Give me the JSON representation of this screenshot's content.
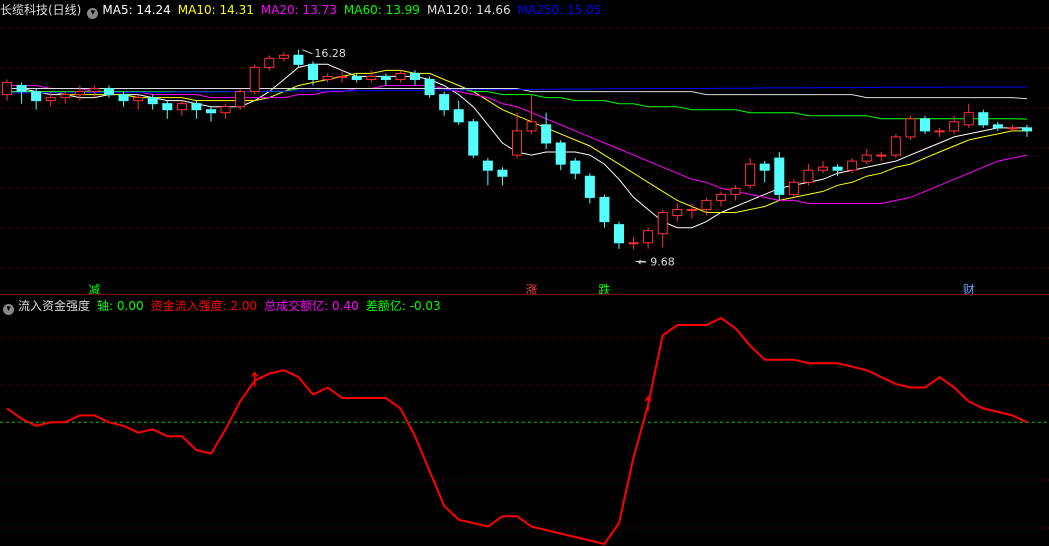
{
  "colors": {
    "up": "#ff3232",
    "down": "#54ffff",
    "background": "#000000",
    "ma5": "#ffffff",
    "ma10": "#ffff00",
    "ma20": "#ff00ff",
    "ma60": "#00ff00",
    "ma120": "#dcdcdc",
    "ma250": "#0000ff",
    "zero_line": "#00c000",
    "indicator": "#ff0000",
    "grid": "#7a0000"
  },
  "top_legend": {
    "icon": "chevron-down-icon",
    "title": "长缆科技(日线)",
    "items": [
      {
        "label": "MA5: 14.24",
        "color": "#ffffff"
      },
      {
        "label": "MA10: 14.31",
        "color": "#ffff00"
      },
      {
        "label": "MA20: 13.73",
        "color": "#ff00ff"
      },
      {
        "label": "MA60: 13.99",
        "color": "#00ff00"
      },
      {
        "label": "MA120: 14.66",
        "color": "#dcdcdc"
      },
      {
        "label": "MA250: 15.05",
        "color": "#0000ff"
      }
    ]
  },
  "bottom_legend": {
    "icon": "chevron-down-icon",
    "title": "流入资金强度",
    "items": [
      {
        "label": "轴: 0.00",
        "color": "#00ff00"
      },
      {
        "label": "资金流入强度: 2.00",
        "color": "#ff0000"
      },
      {
        "label": "总成交额亿: 0.40",
        "color": "#ff00ff"
      },
      {
        "label": "差额亿: -0.03",
        "color": "#00ff00"
      }
    ]
  },
  "chart_data": [
    {
      "type": "candlestick",
      "title": "长缆科技(日线)",
      "ylim": [
        9.0,
        17.2
      ],
      "candles": [
        [
          14.8,
          15.2,
          15.3,
          14.6
        ],
        [
          15.1,
          14.9,
          15.2,
          14.5
        ],
        [
          14.9,
          14.6,
          15.0,
          14.3
        ],
        [
          14.6,
          14.7,
          14.9,
          14.4
        ],
        [
          14.7,
          14.8,
          14.9,
          14.5
        ],
        [
          14.8,
          14.9,
          15.1,
          14.6
        ],
        [
          14.9,
          15.0,
          15.1,
          14.7
        ],
        [
          15.0,
          14.8,
          15.1,
          14.7
        ],
        [
          14.8,
          14.6,
          14.9,
          14.4
        ],
        [
          14.6,
          14.7,
          14.8,
          14.3
        ],
        [
          14.7,
          14.5,
          14.8,
          14.3
        ],
        [
          14.5,
          14.3,
          14.6,
          14.0
        ],
        [
          14.3,
          14.5,
          14.6,
          14.1
        ],
        [
          14.5,
          14.3,
          14.6,
          14.0
        ],
        [
          14.3,
          14.2,
          14.4,
          13.9
        ],
        [
          14.2,
          14.4,
          14.5,
          14.0
        ],
        [
          14.4,
          14.9,
          15.0,
          14.3
        ],
        [
          14.9,
          15.7,
          15.8,
          14.8
        ],
        [
          15.7,
          16.0,
          16.1,
          15.6
        ],
        [
          16.0,
          16.1,
          16.2,
          15.9
        ],
        [
          16.1,
          15.8,
          16.28,
          15.7
        ],
        [
          15.8,
          15.3,
          15.9,
          15.1
        ],
        [
          15.3,
          15.4,
          15.5,
          15.2
        ],
        [
          15.4,
          15.4,
          15.6,
          15.2
        ],
        [
          15.4,
          15.3,
          15.5,
          15.2
        ],
        [
          15.3,
          15.4,
          15.6,
          15.2
        ],
        [
          15.4,
          15.3,
          15.5,
          15.1
        ],
        [
          15.3,
          15.5,
          15.6,
          15.2
        ],
        [
          15.5,
          15.3,
          15.6,
          15.1
        ],
        [
          15.3,
          14.8,
          15.4,
          14.7
        ],
        [
          14.8,
          14.3,
          14.9,
          14.1
        ],
        [
          14.3,
          13.9,
          14.6,
          13.8
        ],
        [
          13.9,
          12.8,
          14.0,
          12.7
        ],
        [
          12.6,
          12.3,
          12.7,
          11.8
        ],
        [
          12.3,
          12.1,
          12.4,
          11.8
        ],
        [
          12.8,
          13.6,
          14.2,
          12.7
        ],
        [
          13.6,
          13.9,
          14.8,
          13.5
        ],
        [
          13.8,
          13.2,
          14.2,
          13.0
        ],
        [
          13.2,
          12.5,
          13.3,
          12.3
        ],
        [
          12.6,
          12.2,
          12.7,
          12.0
        ],
        [
          12.1,
          11.4,
          12.2,
          11.2
        ],
        [
          11.4,
          10.6,
          11.5,
          10.4
        ],
        [
          10.5,
          9.9,
          10.6,
          9.7
        ],
        [
          9.9,
          9.9,
          10.1,
          9.68
        ],
        [
          9.9,
          10.3,
          10.4,
          9.7
        ],
        [
          10.2,
          10.9,
          11.0,
          9.75
        ],
        [
          10.8,
          11.0,
          11.2,
          10.6
        ],
        [
          11.0,
          11.0,
          11.2,
          10.7
        ],
        [
          11.0,
          11.3,
          11.4,
          10.8
        ],
        [
          11.3,
          11.5,
          11.6,
          11.1
        ],
        [
          11.5,
          11.7,
          11.8,
          11.3
        ],
        [
          11.8,
          12.5,
          12.7,
          11.7
        ],
        [
          12.5,
          12.3,
          12.6,
          11.9
        ],
        [
          12.7,
          11.5,
          12.9,
          11.3
        ],
        [
          11.5,
          11.9,
          12.0,
          11.4
        ],
        [
          11.9,
          12.3,
          12.5,
          11.8
        ],
        [
          12.3,
          12.4,
          12.6,
          12.2
        ],
        [
          12.4,
          12.3,
          12.5,
          12.1
        ],
        [
          12.3,
          12.6,
          12.7,
          12.2
        ],
        [
          12.6,
          12.8,
          13.0,
          12.5
        ],
        [
          12.8,
          12.8,
          12.9,
          12.6
        ],
        [
          12.8,
          13.4,
          13.5,
          12.7
        ],
        [
          13.4,
          14.0,
          14.1,
          13.3
        ],
        [
          14.0,
          13.6,
          14.1,
          13.5
        ],
        [
          13.6,
          13.6,
          13.7,
          13.4
        ],
        [
          13.6,
          13.9,
          14.1,
          13.5
        ],
        [
          13.8,
          14.2,
          14.5,
          13.7
        ],
        [
          14.2,
          13.8,
          14.3,
          13.7
        ],
        [
          13.8,
          13.7,
          13.9,
          13.6
        ],
        [
          13.7,
          13.7,
          13.8,
          13.6
        ],
        [
          13.7,
          13.6,
          13.8,
          13.4
        ]
      ],
      "series": [
        {
          "name": "MA5",
          "values": [
            15.0,
            15.0,
            14.9,
            14.8,
            14.8,
            14.7,
            14.7,
            14.8,
            14.8,
            14.8,
            14.7,
            14.6,
            14.6,
            14.5,
            14.4,
            14.4,
            14.4,
            14.6,
            14.9,
            15.3,
            15.7,
            15.8,
            15.8,
            15.6,
            15.4,
            15.4,
            15.4,
            15.4,
            15.4,
            15.3,
            15.1,
            14.8,
            14.4,
            13.8,
            13.2,
            12.9,
            12.8,
            12.9,
            12.9,
            12.9,
            12.8,
            12.5,
            12.0,
            11.4,
            11.0,
            10.6,
            10.4,
            10.4,
            10.6,
            10.9,
            11.1,
            11.3,
            11.5,
            11.7,
            11.8,
            11.9,
            12.0,
            12.2,
            12.3,
            12.4,
            12.5,
            12.6,
            12.8,
            13.0,
            13.2,
            13.4,
            13.5,
            13.6,
            13.7,
            13.7,
            13.7
          ]
        },
        {
          "name": "MA10",
          "values": [
            14.9,
            14.9,
            14.9,
            14.9,
            14.8,
            14.8,
            14.8,
            14.8,
            14.8,
            14.7,
            14.7,
            14.7,
            14.7,
            14.6,
            14.6,
            14.6,
            14.6,
            14.6,
            14.7,
            14.9,
            15.1,
            15.2,
            15.3,
            15.4,
            15.5,
            15.5,
            15.6,
            15.6,
            15.5,
            15.5,
            15.3,
            15.1,
            14.9,
            14.6,
            14.3,
            14.1,
            13.9,
            13.7,
            13.5,
            13.3,
            13.1,
            12.8,
            12.5,
            12.2,
            11.9,
            11.6,
            11.3,
            11.1,
            10.9,
            10.9,
            10.9,
            11.0,
            11.1,
            11.3,
            11.4,
            11.5,
            11.6,
            11.8,
            11.9,
            12.1,
            12.2,
            12.4,
            12.5,
            12.7,
            12.9,
            13.1,
            13.3,
            13.4,
            13.5,
            13.6,
            13.6
          ]
        },
        {
          "name": "MA20",
          "values": [
            15.1,
            15.1,
            15.1,
            15.0,
            15.0,
            15.0,
            14.9,
            14.9,
            14.9,
            14.9,
            14.8,
            14.8,
            14.8,
            14.8,
            14.7,
            14.7,
            14.7,
            14.7,
            14.7,
            14.7,
            14.8,
            14.8,
            14.9,
            14.9,
            15.0,
            15.0,
            15.1,
            15.1,
            15.1,
            15.1,
            15.0,
            14.9,
            14.8,
            14.7,
            14.5,
            14.4,
            14.2,
            14.0,
            13.8,
            13.6,
            13.4,
            13.2,
            13.0,
            12.8,
            12.6,
            12.4,
            12.2,
            12.0,
            11.9,
            11.7,
            11.6,
            11.5,
            11.4,
            11.3,
            11.3,
            11.2,
            11.2,
            11.2,
            11.2,
            11.2,
            11.2,
            11.3,
            11.4,
            11.6,
            11.8,
            12.0,
            12.2,
            12.4,
            12.6,
            12.7,
            12.8
          ]
        },
        {
          "name": "MA60",
          "values": [
            14.9,
            14.9,
            14.9,
            14.9,
            14.9,
            14.9,
            14.9,
            14.9,
            14.9,
            14.9,
            14.9,
            14.9,
            14.9,
            14.9,
            14.9,
            14.9,
            14.9,
            14.9,
            14.9,
            14.9,
            15.0,
            15.0,
            15.0,
            15.0,
            15.0,
            15.0,
            15.0,
            15.0,
            15.0,
            15.0,
            15.0,
            15.0,
            14.9,
            14.9,
            14.8,
            14.8,
            14.8,
            14.7,
            14.7,
            14.6,
            14.6,
            14.6,
            14.5,
            14.5,
            14.4,
            14.4,
            14.4,
            14.3,
            14.3,
            14.3,
            14.3,
            14.2,
            14.2,
            14.2,
            14.2,
            14.1,
            14.1,
            14.1,
            14.1,
            14.1,
            14.0,
            14.0,
            14.0,
            14.0,
            14.0,
            14.0,
            14.0,
            14.0,
            14.0,
            14.0,
            13.99
          ]
        },
        {
          "name": "MA120",
          "values": [
            15.0,
            15.0,
            15.0,
            15.0,
            15.0,
            15.0,
            15.0,
            15.0,
            15.0,
            15.0,
            15.0,
            15.0,
            15.0,
            15.0,
            15.0,
            15.0,
            15.0,
            15.0,
            15.0,
            15.0,
            15.0,
            15.0,
            15.0,
            15.0,
            15.0,
            15.0,
            15.0,
            15.0,
            15.0,
            15.0,
            15.0,
            15.0,
            15.0,
            15.0,
            15.0,
            15.0,
            14.9,
            14.9,
            14.9,
            14.9,
            14.9,
            14.9,
            14.9,
            14.9,
            14.9,
            14.9,
            14.9,
            14.9,
            14.8,
            14.8,
            14.8,
            14.8,
            14.8,
            14.8,
            14.8,
            14.8,
            14.8,
            14.8,
            14.8,
            14.7,
            14.7,
            14.7,
            14.7,
            14.7,
            14.7,
            14.7,
            14.7,
            14.7,
            14.7,
            14.7,
            14.66
          ]
        },
        {
          "name": "MA250",
          "values": [
            14.85,
            14.85,
            14.86,
            14.86,
            14.86,
            14.87,
            14.87,
            14.87,
            14.88,
            14.88,
            14.88,
            14.88,
            14.89,
            14.89,
            14.89,
            14.9,
            14.9,
            14.9,
            14.91,
            14.91,
            14.92,
            14.92,
            14.92,
            14.93,
            14.93,
            14.93,
            14.94,
            14.94,
            14.94,
            14.95,
            14.95,
            14.95,
            14.96,
            14.96,
            14.96,
            14.97,
            14.97,
            14.97,
            14.98,
            14.98,
            14.98,
            14.99,
            14.99,
            14.99,
            15.0,
            15.0,
            15.0,
            15.0,
            15.0,
            15.01,
            15.01,
            15.01,
            15.02,
            15.02,
            15.02,
            15.02,
            15.03,
            15.03,
            15.03,
            15.03,
            15.04,
            15.04,
            15.04,
            15.04,
            15.04,
            15.05,
            15.05,
            15.05,
            15.05,
            15.05,
            15.05
          ]
        }
      ],
      "annotations": [
        {
          "label": "16.28",
          "index": 20,
          "value": 16.28,
          "color": "#dcdcdc"
        },
        {
          "label": "9.68",
          "index": 43,
          "value": 9.68,
          "color": "#dcdcdc"
        }
      ],
      "event_labels": [
        {
          "label": "减",
          "index": 6,
          "color": "#00ff00"
        },
        {
          "label": "涨",
          "index": 36,
          "color": "#ff4040"
        },
        {
          "label": "跌",
          "index": 41,
          "color": "#00ff00"
        },
        {
          "label": "财",
          "index": 66,
          "color": "#5fa8ff"
        }
      ]
    },
    {
      "type": "line",
      "title": "流入资金强度",
      "ylim": [
        -3.5,
        3.0
      ],
      "zero_line": 0.0,
      "series": [
        {
          "name": "资金流入强度",
          "values": [
            0.4,
            0.1,
            -0.1,
            0.0,
            0.0,
            0.2,
            0.2,
            0.0,
            -0.1,
            -0.3,
            -0.2,
            -0.4,
            -0.4,
            -0.8,
            -0.9,
            -0.2,
            0.6,
            1.2,
            1.4,
            1.5,
            1.3,
            0.8,
            1.0,
            0.7,
            0.7,
            0.7,
            0.7,
            0.4,
            -0.4,
            -1.4,
            -2.4,
            -2.8,
            -2.9,
            -3.0,
            -2.7,
            -2.7,
            -3.0,
            -3.1,
            -3.2,
            -3.3,
            -3.4,
            -3.5,
            -2.9,
            -1.0,
            0.5,
            2.5,
            2.8,
            2.8,
            2.8,
            3.0,
            2.7,
            2.2,
            1.8,
            1.8,
            1.8,
            1.7,
            1.7,
            1.7,
            1.6,
            1.5,
            1.3,
            1.1,
            1.0,
            1.0,
            1.3,
            1.0,
            0.6,
            0.4,
            0.3,
            0.2,
            0.0
          ]
        }
      ],
      "markers": [
        {
          "index": 17,
          "color": "#ff0000"
        },
        {
          "index": 44,
          "color": "#ff0000"
        }
      ]
    }
  ]
}
